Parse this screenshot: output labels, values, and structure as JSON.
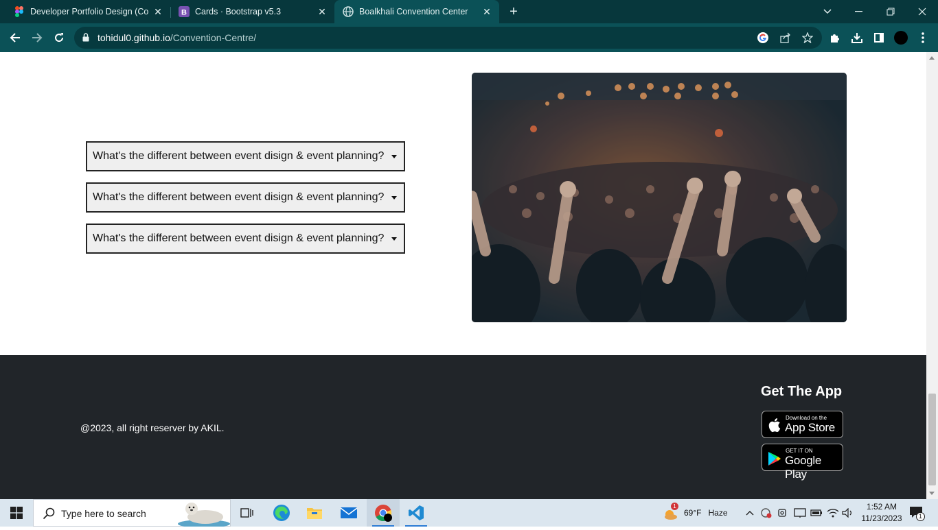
{
  "browser": {
    "tabs": [
      {
        "title": "Developer Portfolio Design (Com",
        "icon": "figma-icon",
        "active": false
      },
      {
        "title": "Cards · Bootstrap v5.3",
        "icon": "bootstrap-icon",
        "active": false
      },
      {
        "title": "Boalkhali Convention Center",
        "icon": "globe-icon",
        "active": true
      }
    ],
    "new_tab": "+",
    "url_host": "tohidul0.github.io",
    "url_path": "/Convention-Centre/"
  },
  "page": {
    "faq": [
      {
        "question": "What's the different between event disign & event planning?"
      },
      {
        "question": "What's the different between event disign & event planning?"
      },
      {
        "question": "What's the different between event disign & event planning?"
      }
    ],
    "image_alt": "concert crowd"
  },
  "footer": {
    "copyright": "@2023, all right reserver by AKIL.",
    "get_app_title": "Get The App",
    "app_store": {
      "small": "Download on the",
      "big": "App Store"
    },
    "google_play": {
      "small": "GET IT ON",
      "big": "Google Play"
    }
  },
  "taskbar": {
    "search_placeholder": "Type here to search",
    "weather_temp": "69°F",
    "weather_desc": "Haze",
    "weather_badge": "1",
    "time": "1:52 AM",
    "date": "11/23/2023",
    "notification_count": "1"
  },
  "colors": {
    "tabbar": "#07373c",
    "toolbar": "#0b5157",
    "footer": "#212529",
    "taskbar": "#dbe6ef"
  }
}
